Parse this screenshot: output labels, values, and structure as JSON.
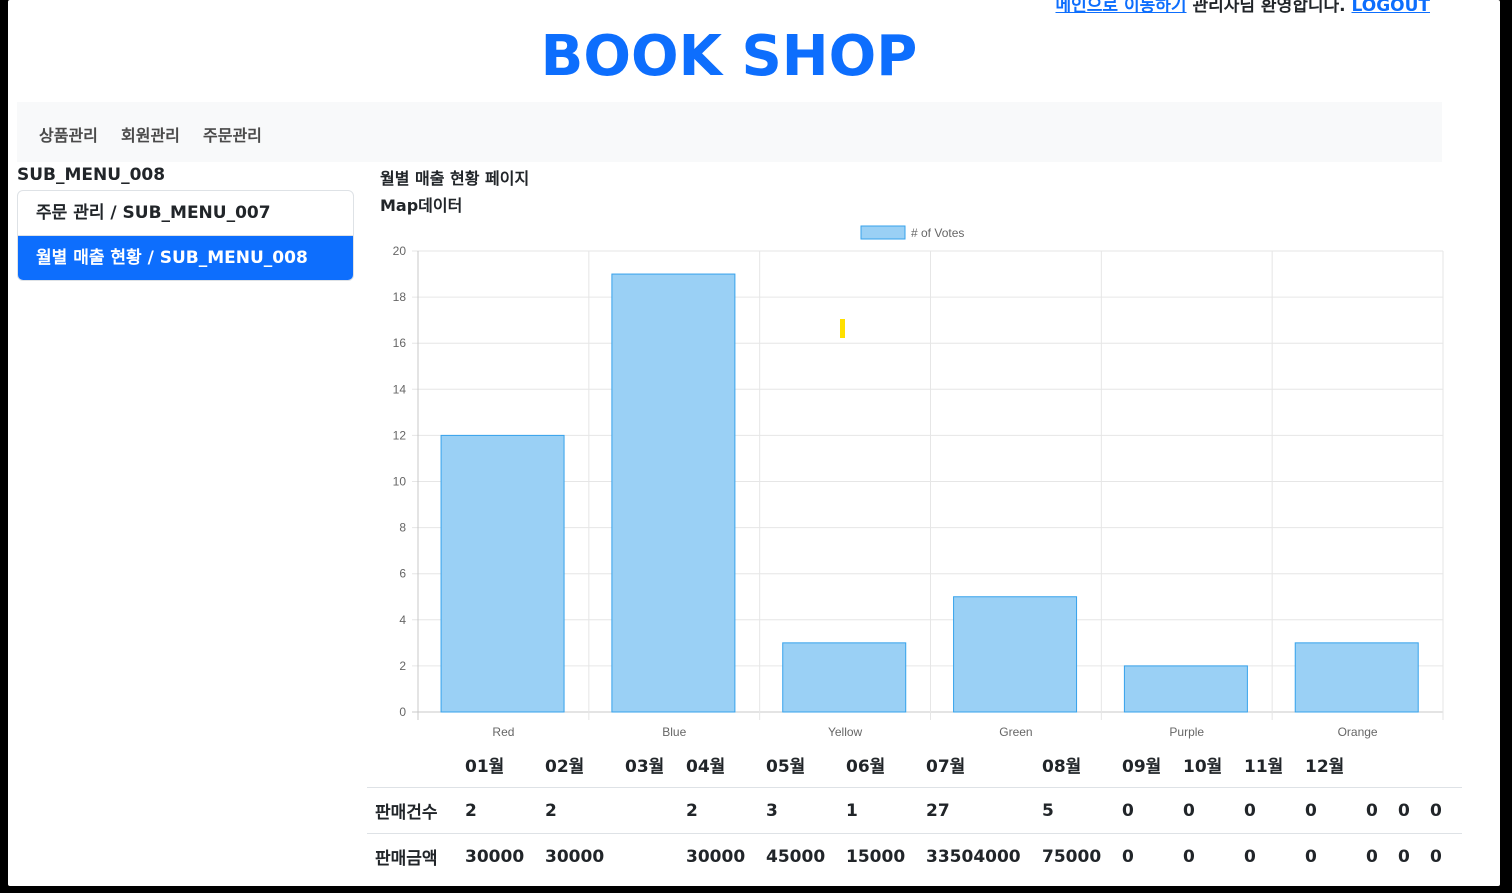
{
  "header": {
    "top_link_1": "메인으로 이동하기",
    "top_text": "관리자님 환영합니다.",
    "top_link_2": "LOGOUT",
    "brand": "BOOK SHOP"
  },
  "nav": {
    "items": [
      "상품관리",
      "회원관리",
      "주문관리"
    ]
  },
  "sidebar": {
    "title": "SUB_MENU_008",
    "items": [
      {
        "label": "주문 관리 / SUB_MENU_007",
        "active": false
      },
      {
        "label": "월별 매출 현황 / SUB_MENU_008",
        "active": true
      }
    ]
  },
  "main": {
    "title": "월별 매출 현황 페이지",
    "subtitle": "Map데이터"
  },
  "chart_data": {
    "type": "bar",
    "categories": [
      "Red",
      "Blue",
      "Yellow",
      "Green",
      "Purple",
      "Orange"
    ],
    "series": [
      {
        "name": "# of Votes",
        "values": [
          12,
          19,
          3,
          5,
          2,
          3
        ]
      }
    ],
    "ylim": [
      0,
      20
    ],
    "yticks": [
      0,
      2,
      4,
      6,
      8,
      10,
      12,
      14,
      16,
      18,
      20
    ],
    "grid": true,
    "legend": "top-center",
    "colors": {
      "fill": "#9ad0f5",
      "stroke": "#36a2eb"
    }
  },
  "table": {
    "months": [
      "01월",
      "02월",
      "03월",
      "04월",
      "05월",
      "06월",
      "07월",
      "08월",
      "09월",
      "10월",
      "11월",
      "12월"
    ],
    "rows": [
      {
        "label": "판매건수",
        "values": [
          "2",
          "2",
          "",
          "2",
          "3",
          "1",
          "27",
          "5",
          "0",
          "0",
          "0",
          "0"
        ],
        "extra": [
          "0",
          "0",
          "0"
        ]
      },
      {
        "label": "판매금액",
        "values": [
          "30000",
          "30000",
          "",
          "30000",
          "45000",
          "15000",
          "33504000",
          "75000",
          "0",
          "0",
          "0",
          "0"
        ],
        "extra": [
          "0",
          "0",
          "0"
        ]
      }
    ]
  }
}
